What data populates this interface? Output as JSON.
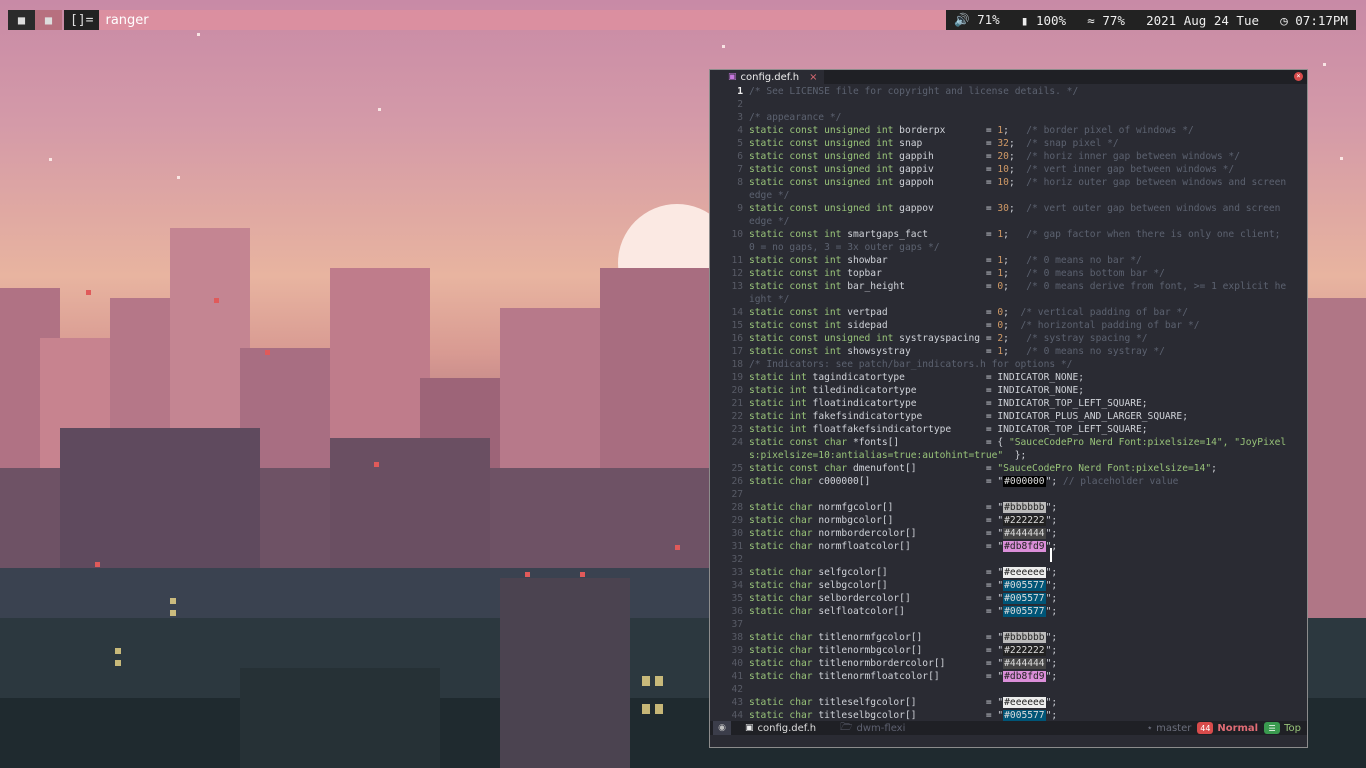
{
  "topbar": {
    "tags": [
      "■",
      "■"
    ],
    "layout": "[]=",
    "window_title": "ranger",
    "volume": "71%",
    "battery": "100%",
    "wifi": "77%",
    "date": "2021 Aug 24 Tue",
    "time": "07:17PM",
    "icons": {
      "volume": "volume-icon",
      "battery": "battery-icon",
      "wifi": "wifi-icon",
      "clock": "clock-icon"
    }
  },
  "editor": {
    "tab_title": "config.def.h",
    "close_glyph": "×",
    "status": {
      "file": "config.def.h",
      "dir": "dwm-flexi",
      "branch": "master",
      "mode": "Normal",
      "position": "Top",
      "mode_badge": "44",
      "pos_badge": "☰"
    },
    "lines": [
      {
        "n": "1",
        "t": "/* See LICENSE file for copyright and license details. */"
      },
      {
        "n": "2",
        "t": ""
      },
      {
        "n": "3",
        "t": "/* appearance */"
      },
      {
        "n": "4",
        "t": "static const unsigned int borderpx       = 1;   /* border pixel of windows */"
      },
      {
        "n": "5",
        "t": "static const unsigned int snap           = 32;  /* snap pixel */"
      },
      {
        "n": "6",
        "t": "static const unsigned int gappih         = 20;  /* horiz inner gap between windows */"
      },
      {
        "n": "7",
        "t": "static const unsigned int gappiv         = 10;  /* vert inner gap between windows */"
      },
      {
        "n": "8",
        "t": "static const unsigned int gappoh         = 10;  /* horiz outer gap between windows and screen"
      },
      {
        "n": "",
        "t": "edge */"
      },
      {
        "n": "9",
        "t": "static const unsigned int gappov         = 30;  /* vert outer gap between windows and screen"
      },
      {
        "n": "",
        "t": "edge */"
      },
      {
        "n": "10",
        "t": "static const int smartgaps_fact          = 1;   /* gap factor when there is only one client;"
      },
      {
        "n": "",
        "t": "0 = no gaps, 3 = 3x outer gaps */"
      },
      {
        "n": "11",
        "t": "static const int showbar                 = 1;   /* 0 means no bar */"
      },
      {
        "n": "12",
        "t": "static const int topbar                  = 1;   /* 0 means bottom bar */"
      },
      {
        "n": "13",
        "t": "static const int bar_height              = 0;   /* 0 means derive from font, >= 1 explicit he"
      },
      {
        "n": "",
        "t": "ight */"
      },
      {
        "n": "14",
        "t": "static const int vertpad                 = 0;  /* vertical padding of bar */"
      },
      {
        "n": "15",
        "t": "static const int sidepad                 = 0;  /* horizontal padding of bar */"
      },
      {
        "n": "16",
        "t": "static const unsigned int systrayspacing = 2;   /* systray spacing */"
      },
      {
        "n": "17",
        "t": "static const int showsystray             = 1;   /* 0 means no systray */"
      },
      {
        "n": "18",
        "t": "/* Indicators: see patch/bar_indicators.h for options */"
      },
      {
        "n": "19",
        "t": "static int tagindicatortype              = INDICATOR_NONE;"
      },
      {
        "n": "20",
        "t": "static int tiledindicatortype            = INDICATOR_NONE;"
      },
      {
        "n": "21",
        "t": "static int floatindicatortype            = INDICATOR_TOP_LEFT_SQUARE;"
      },
      {
        "n": "22",
        "t": "static int fakefsindicatortype           = INDICATOR_PLUS_AND_LARGER_SQUARE;"
      },
      {
        "n": "23",
        "t": "static int floatfakefsindicatortype      = INDICATOR_TOP_LEFT_SQUARE;"
      },
      {
        "n": "24",
        "t": "static const char *fonts[]               = { \"SauceCodePro Nerd Font:pixelsize=14\", \"JoyPixel"
      },
      {
        "n": "",
        "t": "s:pixelsize=10:antialias=true:autohint=true\"  };"
      },
      {
        "n": "25",
        "t": "static const char dmenufont[]            = \"SauceCodePro Nerd Font:pixelsize=14\";"
      },
      {
        "n": "26",
        "t": "static char c000000[]                    = \"#000000\"; // placeholder value"
      },
      {
        "n": "27",
        "t": ""
      },
      {
        "n": "28",
        "t": "static char normfgcolor[]                = \"#bbbbbb\";"
      },
      {
        "n": "29",
        "t": "static char normbgcolor[]                = \"#222222\";"
      },
      {
        "n": "30",
        "t": "static char normbordercolor[]            = \"#444444\";"
      },
      {
        "n": "31",
        "t": "static char normfloatcolor[]             = \"#db8fd9\";"
      },
      {
        "n": "32",
        "t": ""
      },
      {
        "n": "33",
        "t": "static char selfgcolor[]                 = \"#eeeeee\";"
      },
      {
        "n": "34",
        "t": "static char selbgcolor[]                 = \"#005577\";"
      },
      {
        "n": "35",
        "t": "static char selbordercolor[]             = \"#005577\";"
      },
      {
        "n": "36",
        "t": "static char selfloatcolor[]              = \"#005577\";"
      },
      {
        "n": "37",
        "t": ""
      },
      {
        "n": "38",
        "t": "static char titlenormfgcolor[]           = \"#bbbbbb\";"
      },
      {
        "n": "39",
        "t": "static char titlenormbgcolor[]           = \"#222222\";"
      },
      {
        "n": "40",
        "t": "static char titlenormbordercolor[]       = \"#444444\";"
      },
      {
        "n": "41",
        "t": "static char titlenormfloatcolor[]        = \"#db8fd9\";"
      },
      {
        "n": "42",
        "t": ""
      },
      {
        "n": "43",
        "t": "static char titleselfgcolor[]            = \"#eeeeee\";"
      },
      {
        "n": "44",
        "t": "static char titleselbgcolor[]            = \"#005577\";"
      }
    ]
  }
}
